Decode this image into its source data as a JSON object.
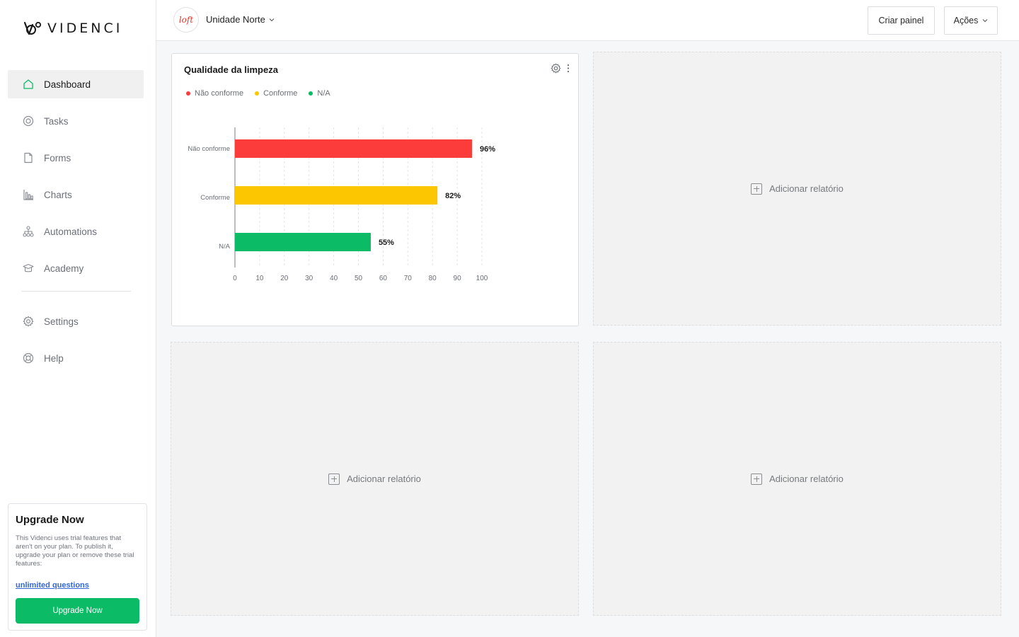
{
  "brand": {
    "name": "VIDENCI"
  },
  "sidebar": {
    "items": [
      {
        "label": "Dashboard",
        "icon": "home-icon",
        "active": true
      },
      {
        "label": "Tasks",
        "icon": "target-icon"
      },
      {
        "label": "Forms",
        "icon": "document-icon"
      },
      {
        "label": "Charts",
        "icon": "bar-chart-icon"
      },
      {
        "label": "Automations",
        "icon": "hierarchy-icon"
      },
      {
        "label": "Academy",
        "icon": "graduation-cap-icon"
      }
    ],
    "bottom_items": [
      {
        "label": "Settings",
        "icon": "gear-icon"
      },
      {
        "label": "Help",
        "icon": "lifebuoy-icon"
      }
    ]
  },
  "upgrade": {
    "title": "Upgrade Now",
    "text": "This Videnci uses trial features that aren't on your plan. To publish it, upgrade your plan or remove these trial features:",
    "link": "unlimited questions",
    "button": "Upgrade Now"
  },
  "header": {
    "unit_logo_text": "loft",
    "unit_name": "Unidade Norte",
    "create_panel": "Criar painel",
    "actions": "Ações"
  },
  "panels": {
    "add_report": "Adicionar relatório"
  },
  "chart_data": {
    "type": "bar",
    "orientation": "horizontal",
    "title": "Qualidade da limpeza",
    "categories": [
      "Não conforme",
      "Conforme",
      "N/A"
    ],
    "values": [
      96,
      82,
      55
    ],
    "value_labels": [
      "96%",
      "82%",
      "55%"
    ],
    "colors": [
      "#fc3b3b",
      "#fcc700",
      "#0cbb65"
    ],
    "legend": [
      "Não conforme",
      "Conforme",
      "N/A"
    ],
    "legend_placement": "top-left",
    "xlim": [
      0,
      100
    ],
    "xticks": [
      0,
      10,
      20,
      30,
      40,
      50,
      60,
      70,
      80,
      90,
      100
    ],
    "grid": true
  },
  "colors": {
    "accent": "#0cbb65",
    "link": "#3367d6",
    "active_nav_bg": "#f0f0f1"
  }
}
